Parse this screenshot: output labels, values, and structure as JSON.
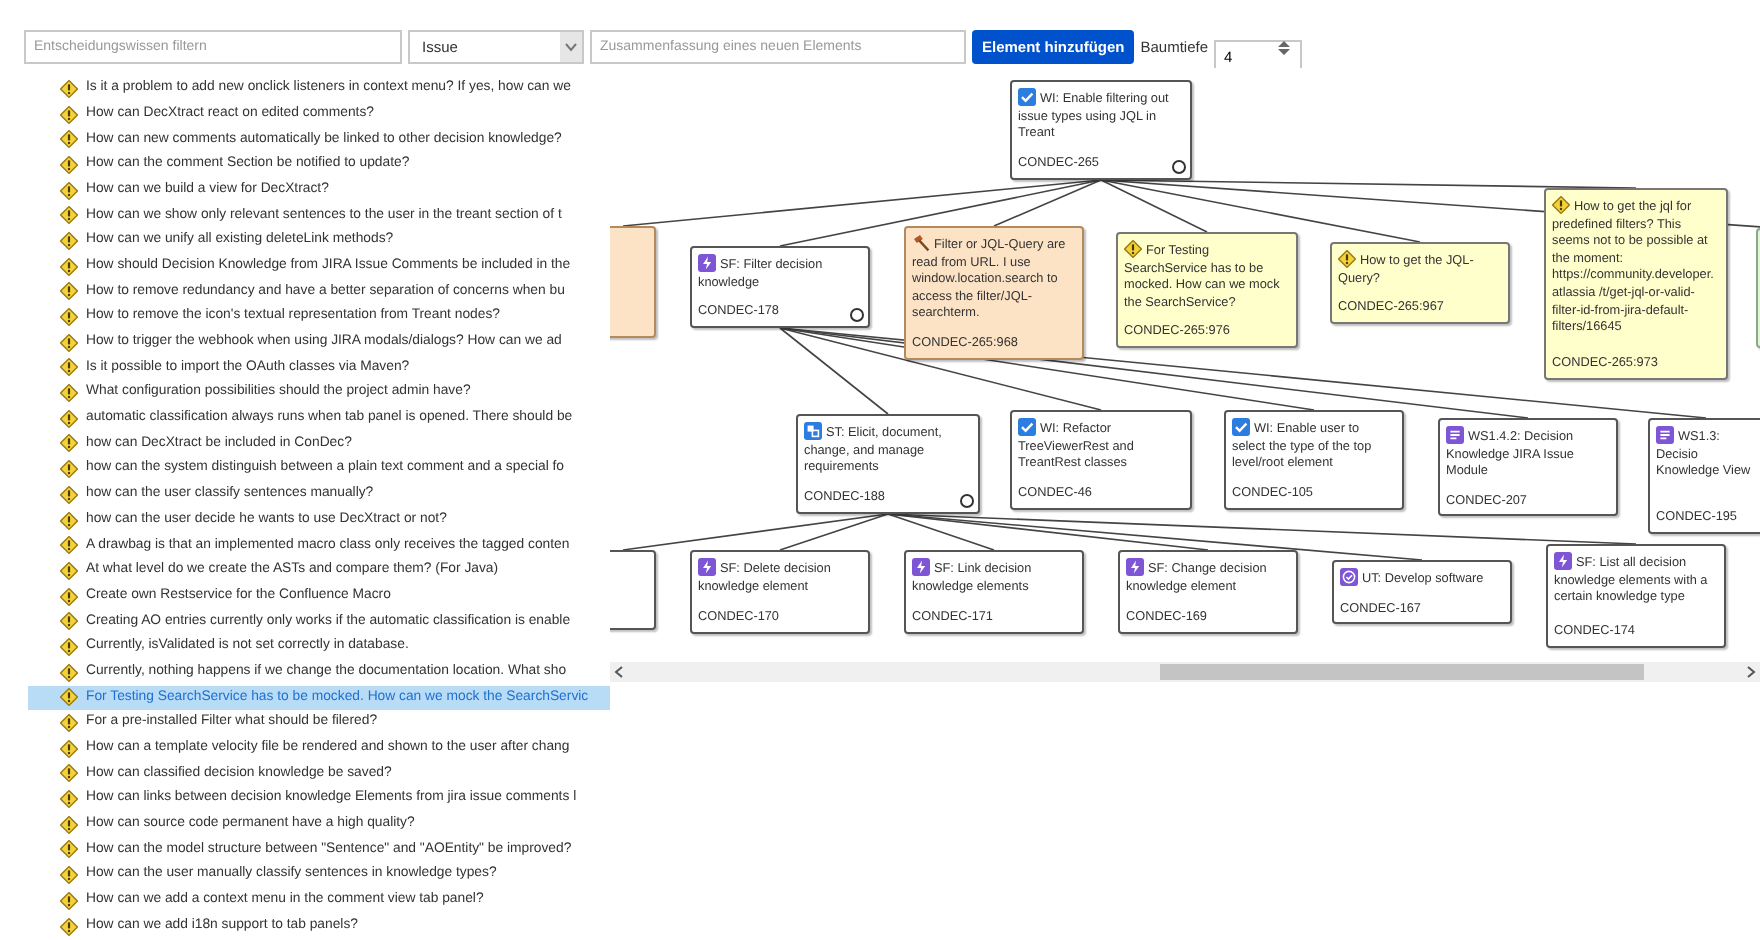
{
  "toolbar": {
    "filter": {
      "placeholder": "Entscheidungswissen filtern"
    },
    "type_select": {
      "value": "Issue"
    },
    "summary": {
      "placeholder": "Zusammenfassung eines neuen Elements"
    },
    "add_button": "Element hinzufügen",
    "depth_label": "Baumtiefe",
    "depth": {
      "value": "4"
    }
  },
  "list": [
    {
      "text": "Is it a problem to add new onclick listeners in context menu? If yes, how can we",
      "selected": false
    },
    {
      "text": "How can DecXtract react on edited comments?",
      "selected": false
    },
    {
      "text": "How can new comments automatically be linked to other decision knowledge?",
      "selected": false
    },
    {
      "text": "How can the comment Section be notified to update?",
      "selected": false
    },
    {
      "text": "How can we build a view for DecXtract?",
      "selected": false
    },
    {
      "text": "How can we show only relevant sentences to the user in the treant section of t",
      "selected": false
    },
    {
      "text": "How can we unify all existing deleteLink methods?",
      "selected": false
    },
    {
      "text": "How should Decision Knowledge from JIRA Issue Comments be included in the",
      "selected": false
    },
    {
      "text": "How to remove redundancy and have a better separation of concerns when bu",
      "selected": false
    },
    {
      "text": "How to remove the icon's textual representation from Treant nodes?",
      "selected": false
    },
    {
      "text": "How to trigger the webhook when using JIRA modals/dialogs? How can we ad",
      "selected": false
    },
    {
      "text": "Is it possible to import the OAuth classes via Maven?",
      "selected": false
    },
    {
      "text": "What configuration possibilities should the project admin have?",
      "selected": false
    },
    {
      "text": "automatic classification always runs when tab panel is opened. There should be",
      "selected": false
    },
    {
      "text": "how can DecXtract be included in ConDec?",
      "selected": false
    },
    {
      "text": "how can the system distinguish between a plain text comment and a special fo",
      "selected": false
    },
    {
      "text": "how can the user classify sentences manually?",
      "selected": false
    },
    {
      "text": "how can the user decide he wants to use DecXtract or not?",
      "selected": false
    },
    {
      "text": "A drawbag is that an implemented macro class only receives the tagged conten",
      "selected": false
    },
    {
      "text": "At what level do we create the ASTs and compare them? (For Java)",
      "selected": false
    },
    {
      "text": "Create own Restservice for the Confluence Macro",
      "selected": false
    },
    {
      "text": "Creating AO entries currently only works if the automatic classification is enable",
      "selected": false
    },
    {
      "text": "Currently, isValidated is not set correctly in database.",
      "selected": false
    },
    {
      "text": "Currently, nothing happens if we change the documentation location. What sho",
      "selected": false
    },
    {
      "text": "For Testing SearchService has to be mocked. How can we mock the SearchServic",
      "selected": true
    },
    {
      "text": "For a pre-installed Filter what should be filered?",
      "selected": false
    },
    {
      "text": "How can a template velocity file be rendered and shown to the user after chang",
      "selected": false
    },
    {
      "text": "How can classified decision knowledge be saved?",
      "selected": false
    },
    {
      "text": "How can links between decision knowledge Elements from jira issue comments l",
      "selected": false
    },
    {
      "text": "How can source code permanent have a high quality?",
      "selected": false
    },
    {
      "text": "How can the model structure between \"Sentence\" and \"AOEntity\" be improved?",
      "selected": false
    },
    {
      "text": "How can the user manually classify sentences in knowledge types?",
      "selected": false
    },
    {
      "text": "How can we add a context menu in the comment view tab panel?",
      "selected": false
    },
    {
      "text": "How can we add i18n support to tab panels?",
      "selected": false
    }
  ],
  "tree": {
    "root": {
      "kind": "work_item",
      "summary": "WI: Enable filtering out issue types using JQL in Treant",
      "key": "CONDEC-265",
      "collapse_handle": true,
      "children": [
        {
          "kind": "decision",
          "collapse_handle": false
        },
        {
          "kind": "feature",
          "summary": "SF: Filter decision knowledge",
          "key": "CONDEC-178",
          "collapse_handle": true,
          "children": [
            {
              "kind": "story",
              "summary": "ST: Elicit, document, change, and manage requirements",
              "key": "CONDEC-188",
              "collapse_handle": true,
              "children": [
                {
                  "kind": "feature",
                  "collapse_handle": false
                },
                {
                  "kind": "feature",
                  "summary": "SF: Delete decision knowledge element",
                  "key": "CONDEC-170",
                  "collapse_handle": false
                },
                {
                  "kind": "feature",
                  "summary": "SF: Link decision knowledge elements",
                  "key": "CONDEC-171",
                  "collapse_handle": false
                },
                {
                  "kind": "feature",
                  "summary": "SF: Change decision knowledge element",
                  "key": "CONDEC-169",
                  "collapse_handle": false
                },
                {
                  "kind": "user_task",
                  "summary": "UT: Develop software",
                  "key": "CONDEC-167",
                  "collapse_handle": false
                },
                {
                  "kind": "feature",
                  "summary": "SF: List all decision knowledge elements with a certain knowledge type",
                  "key": "CONDEC-174",
                  "collapse_handle": false
                }
              ]
            },
            {
              "kind": "work_item",
              "summary": "WI: Refactor TreeViewerRest and TreantRest classes",
              "key": "CONDEC-46",
              "collapse_handle": false
            },
            {
              "kind": "work_item",
              "summary": "WI: Enable user to select the type of the top level/root element",
              "key": "CONDEC-105",
              "collapse_handle": false
            },
            {
              "kind": "work_package",
              "summary": "WS1.4.2: Decision Knowledge JIRA Issue Module",
              "key": "CONDEC-207",
              "collapse_handle": false
            },
            {
              "kind": "work_package",
              "summary": "WS1.3: Decisio Knowledge View",
              "key": "CONDEC-195",
              "collapse_handle": false
            }
          ]
        },
        {
          "kind": "decision",
          "summary": "Filter or JQL-Query are read from URL. I use window.location.search to access the filter/JQL-searchterm.",
          "key": "CONDEC-265:968",
          "collapse_handle": false
        },
        {
          "kind": "issue",
          "summary": "For Testing SearchService has to be mocked. How can we mock the SearchService?",
          "key": "CONDEC-265:976",
          "collapse_handle": false
        },
        {
          "kind": "issue",
          "summary": "How to get the JQL-Query?",
          "key": "CONDEC-265:967",
          "collapse_handle": false
        },
        {
          "kind": "issue",
          "summary": "How to get the jql for predefined filters? This seems not to be possible at the moment: https://community.developer.atlassia /t/get-jql-or-valid-filter-id-from-jira-default-filters/16645",
          "key": "CONDEC-265:973",
          "collapse_handle": false
        },
        {
          "kind": "alternative",
          "collapse_handle": false
        }
      ]
    }
  }
}
